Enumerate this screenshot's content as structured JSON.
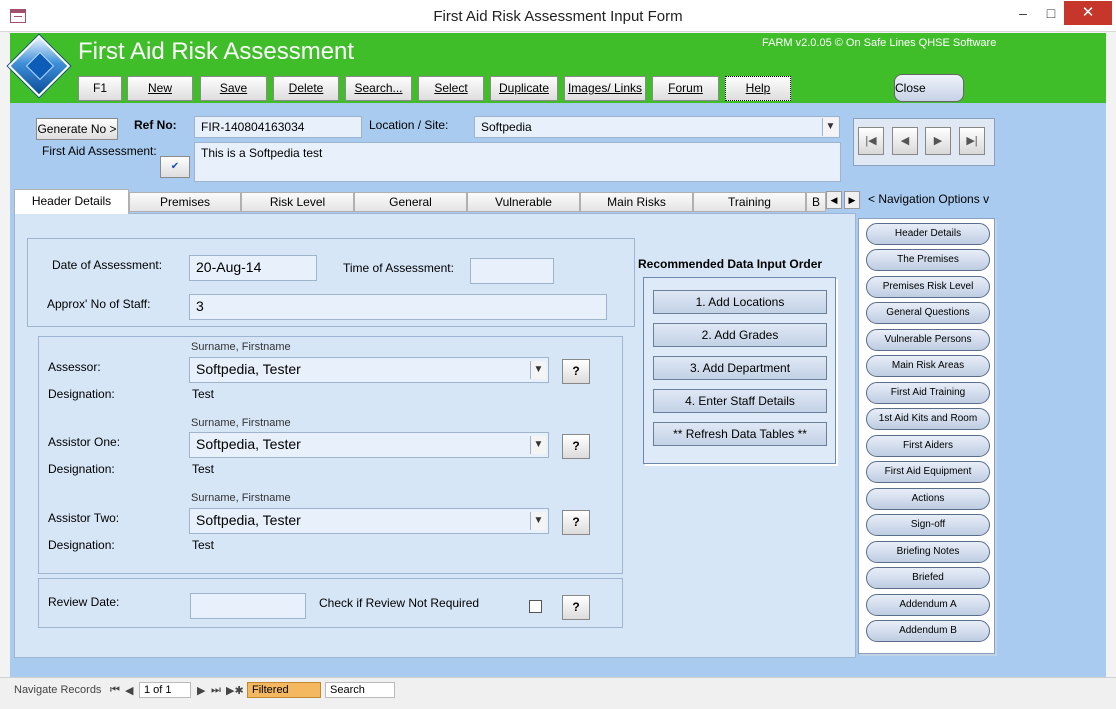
{
  "window": {
    "title": "First Aid Risk Assessment Input Form",
    "controls": {
      "minimize": "–",
      "maximize": "□",
      "close": "✕"
    }
  },
  "header": {
    "title": "First Aid Risk Assessment",
    "version": "FARM v2.0.05 © On Safe Lines QHSE Software",
    "toolbar": [
      "F1",
      "New",
      "Save",
      "Delete",
      "Search...",
      "Select",
      "Duplicate",
      "Images/ Links",
      "Forum",
      "Help"
    ],
    "close_label": "Close"
  },
  "record": {
    "generate_label": "Generate No >",
    "ref_label": "Ref No:",
    "ref_value": "FIR-140804163034",
    "location_label": "Location / Site:",
    "location_value": "Softpedia",
    "assessment_label": "First Aid Assessment:",
    "assessment_value": "This is a Softpedia test"
  },
  "nav_arrows": [
    "|◀",
    "◀",
    "▶",
    "▶|"
  ],
  "tabs": [
    "Header Details",
    "Premises",
    "Risk Level",
    "General",
    "Vulnerable",
    "Main Risks",
    "Training",
    "B"
  ],
  "active_tab": "Header Details",
  "nav_options_label": "< Navigation Options v",
  "details": {
    "date_label": "Date of Assessment:",
    "date_value": "20-Aug-14",
    "time_label": "Time of Assessment:",
    "time_value": "",
    "staff_label": "Approx' No of Staff:",
    "staff_value": "3",
    "hint": "Surname, Firstname",
    "people": [
      {
        "role_label": "Assessor:",
        "name": "Softpedia, Tester",
        "designation_label": "Designation:",
        "designation": "Test"
      },
      {
        "role_label": "Assistor One:",
        "name": "Softpedia, Tester",
        "designation_label": "Designation:",
        "designation": "Test"
      },
      {
        "role_label": "Assistor Two:",
        "name": "Softpedia, Tester",
        "designation_label": "Designation:",
        "designation": "Test"
      }
    ],
    "help_label": "?",
    "review_label": "Review Date:",
    "review_value": "",
    "review_check_label": "Check if Review Not Required"
  },
  "recommended": {
    "title": "Recommended Data Input Order",
    "buttons": [
      "1. Add Locations",
      "2. Add Grades",
      "3. Add Department",
      "4. Enter Staff Details",
      "** Refresh Data Tables **"
    ]
  },
  "nav_options": [
    "Header Details",
    "The Premises",
    "Premises Risk Level",
    "General Questions",
    "Vulnerable Persons",
    "Main Risk Areas",
    "First Aid Training",
    "1st Aid Kits and Room",
    "First Aiders",
    "First Aid Equipment",
    "Actions",
    "Sign-off",
    "Briefing Notes",
    "Briefed",
    "Addendum A",
    "Addendum B"
  ],
  "statusbar": {
    "label": "Navigate Records",
    "first": "⏮",
    "prev": "◀",
    "position": "1 of 1",
    "next": "▶",
    "last": "⏭",
    "new": "▶✱",
    "filtered": "Filtered",
    "search": "Search"
  },
  "colors": {
    "header_green": "#3fbe2a",
    "body_blue": "#a8cbef",
    "panel_blue": "#d6e6f7",
    "close_red": "#c7362b"
  }
}
